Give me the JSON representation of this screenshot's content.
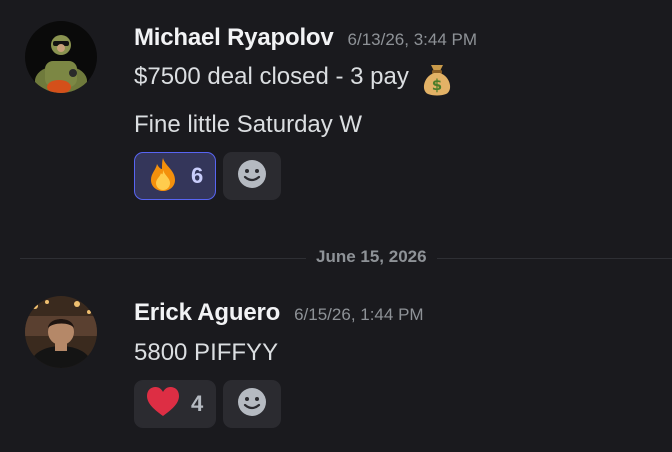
{
  "messages": [
    {
      "author": "Michael Ryapolov",
      "timestamp": "6/13/26, 3:44 PM",
      "lines": [
        "$7500 deal closed - 3 pay",
        "Fine little Saturday W"
      ],
      "inline_emoji": "money-bag-icon",
      "reactions": [
        {
          "emoji": "fire-icon",
          "count": "6",
          "active": true
        }
      ],
      "add_reaction_icon": "smiley-add-reaction-icon"
    },
    {
      "author": "Erick Aguero",
      "timestamp": "6/15/26, 1:44 PM",
      "lines": [
        "5800 PIFFYY"
      ],
      "reactions": [
        {
          "emoji": "red-heart-icon",
          "count": "4",
          "active": false
        }
      ],
      "add_reaction_icon": "smiley-add-reaction-icon"
    }
  ],
  "divider": {
    "date": "June 15, 2026"
  },
  "colors": {
    "background": "#1a1a1e",
    "active_reaction_border": "#5865f2",
    "active_reaction_bg": "#34365a",
    "reaction_bg": "#2b2b30"
  }
}
